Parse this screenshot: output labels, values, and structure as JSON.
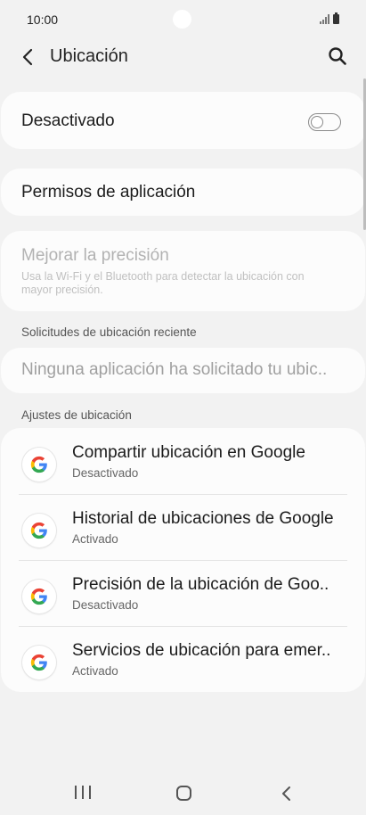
{
  "status_bar": {
    "time": "10:00"
  },
  "header": {
    "title": "Ubicación"
  },
  "toggle_card": {
    "label": "Desactivado",
    "enabled": false
  },
  "permissions": {
    "label": "Permisos de aplicación"
  },
  "improve_accuracy": {
    "title": "Mejorar la precisión",
    "description": "Usa la Wi-Fi y el Bluetooth para detectar la ubicación con mayor precisión."
  },
  "recent_section": {
    "header": "Solicitudes de ubicación reciente",
    "empty_text": "Ninguna aplicación ha solicitado tu ubic.."
  },
  "settings_section": {
    "header": "Ajustes de ubicación",
    "items": [
      {
        "title": "Compartir ubicación en Google",
        "subtitle": "Desactivado",
        "icon": "google-icon"
      },
      {
        "title": "Historial de ubicaciones de Google",
        "subtitle": "Activado",
        "icon": "google-icon"
      },
      {
        "title": "Precisión de la ubicación de Goo..",
        "subtitle": "Desactivado",
        "icon": "google-icon"
      },
      {
        "title": "Servicios de ubicación para emer..",
        "subtitle": "Activado",
        "icon": "google-icon"
      }
    ]
  },
  "colors": {
    "background": "#f2f2f2",
    "card": "#fcfcfc",
    "google_blue": "#4285F4",
    "google_red": "#EA4335",
    "google_yellow": "#FBBC05",
    "google_green": "#34A853"
  }
}
